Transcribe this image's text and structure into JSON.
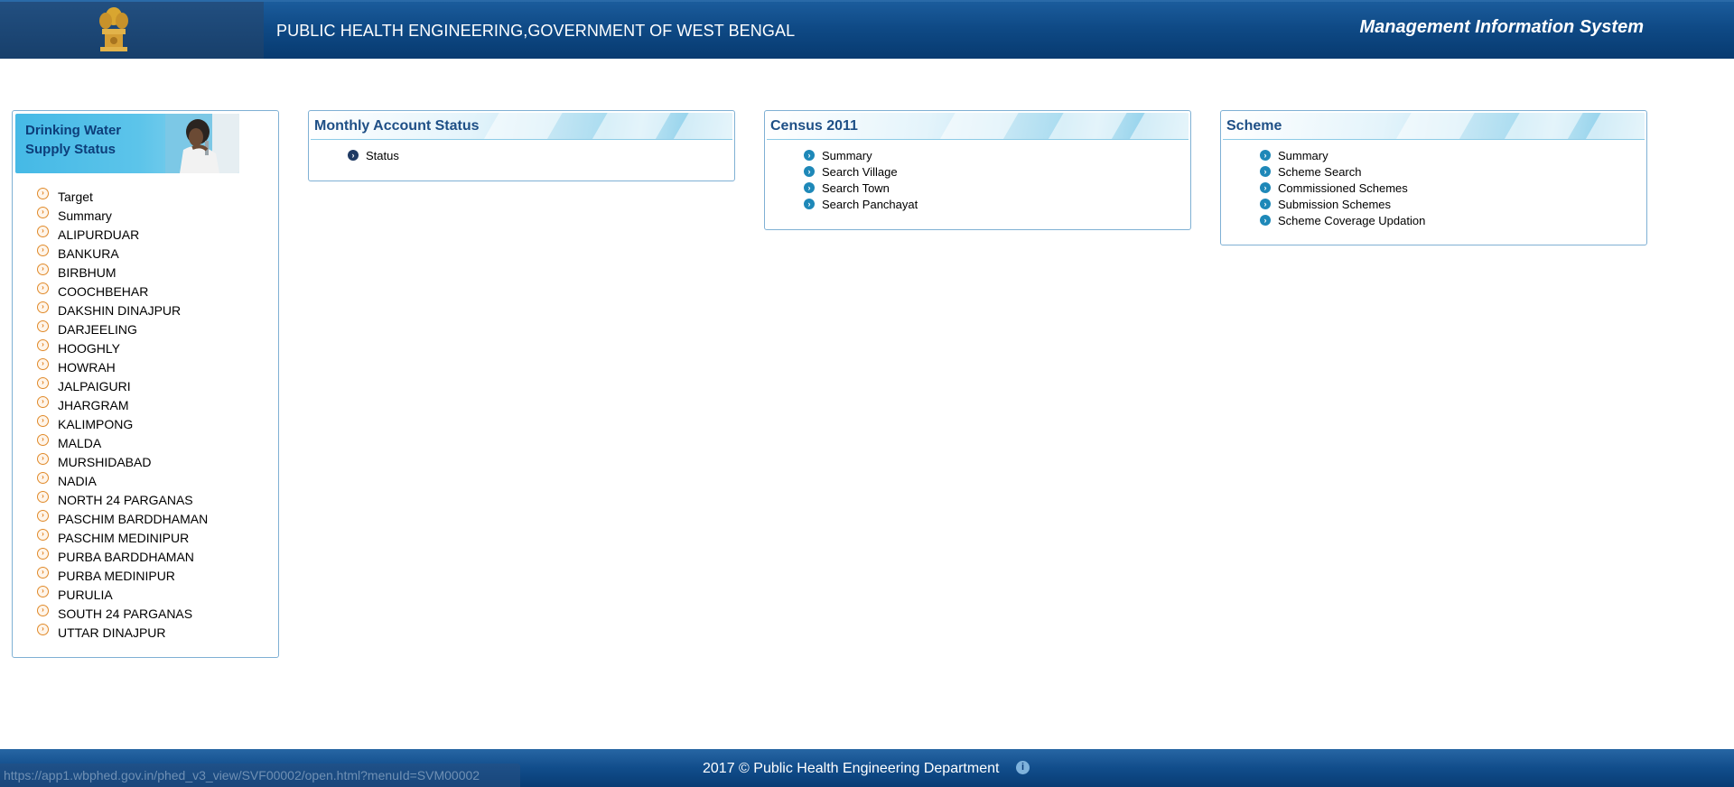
{
  "header": {
    "title": "PUBLIC HEALTH ENGINEERING,GOVERNMENT OF WEST BENGAL",
    "system_name": "Management Information System",
    "emblem_icon": "state-emblem-icon"
  },
  "drinking_water": {
    "banner_line1": "Drinking Water",
    "banner_line2": "Supply Status",
    "items": [
      "Target",
      "Summary",
      "ALIPURDUAR",
      "BANKURA",
      "BIRBHUM",
      "COOCHBEHAR",
      "DAKSHIN DINAJPUR",
      "DARJEELING",
      "HOOGHLY",
      "HOWRAH",
      "JALPAIGURI",
      "JHARGRAM",
      "KALIMPONG",
      "MALDA",
      "MURSHIDABAD",
      "NADIA",
      "NORTH 24 PARGANAS",
      "PASCHIM BARDDHAMAN",
      "PASCHIM MEDINIPUR",
      "PURBA BARDDHAMAN",
      "PURBA MEDINIPUR",
      "PURULIA",
      "SOUTH 24 PARGANAS",
      "UTTAR DINAJPUR"
    ]
  },
  "monthly_account": {
    "title": "Monthly Account Status",
    "items": [
      "Status"
    ]
  },
  "census": {
    "title": "Census 2011",
    "items": [
      "Summary",
      "Search Village",
      "Search Town",
      "Search Panchayat"
    ]
  },
  "scheme": {
    "title": "Scheme",
    "items": [
      "Summary",
      "Scheme Search",
      "Commissioned Schemes",
      "Submission Schemes",
      "Scheme Coverage Updation"
    ]
  },
  "footer": {
    "text": "2017 © Public Health Engineering Department",
    "info_icon": "info-icon"
  },
  "status_bar": {
    "url": "https://app1.wbphed.gov.in/phed_v3_view/SVF00002/open.html?menuId=SVM00002"
  },
  "colors": {
    "header_blue": "#0f4a86",
    "panel_title": "#1e4f86",
    "bullet_blue": "#1e88b8",
    "bullet_orange": "#e08a2a"
  }
}
